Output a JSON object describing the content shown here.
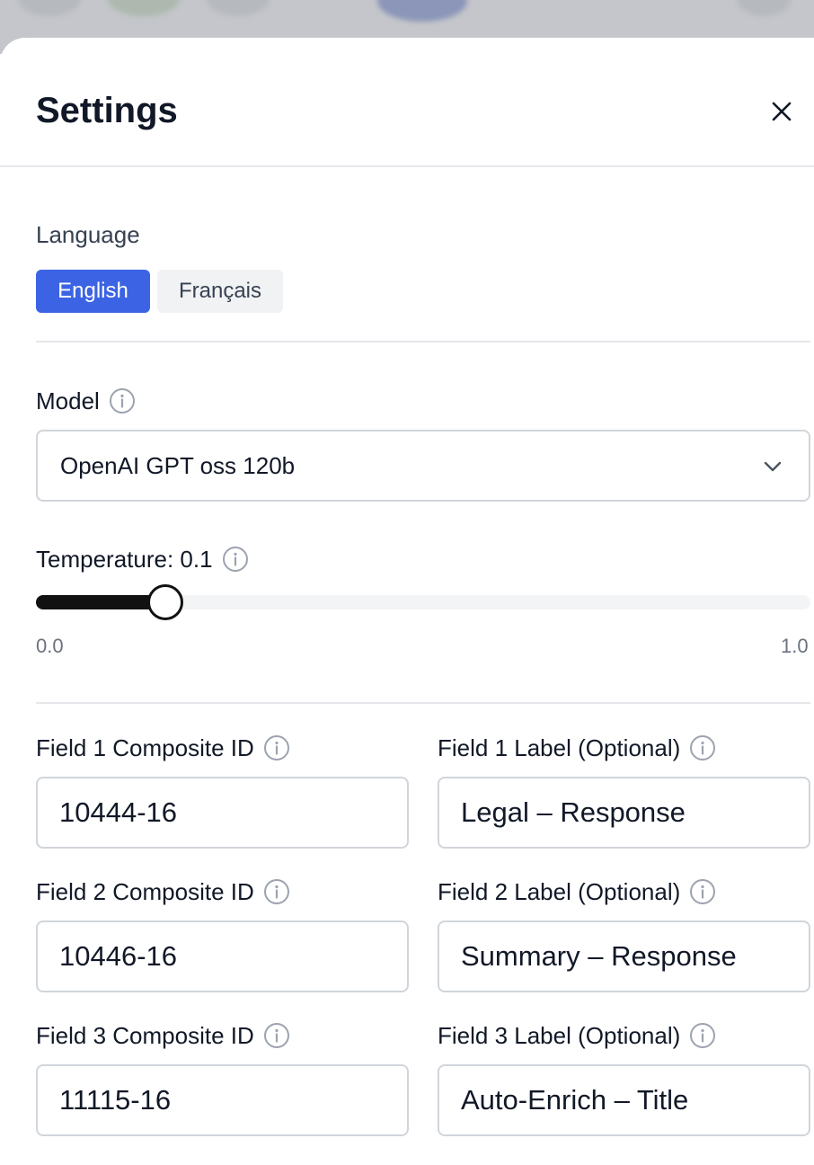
{
  "settings": {
    "title": "Settings",
    "language": {
      "label": "Language",
      "options": [
        "English",
        "Français"
      ],
      "selected": "English"
    },
    "model": {
      "label": "Model",
      "selected_value": "OpenAI GPT oss 120b"
    },
    "temperature": {
      "label": "Temperature: 0.1",
      "value": 0.1,
      "min_label": "0.0",
      "max_label": "1.0"
    },
    "fields": [
      {
        "id_label": "Field 1 Composite ID",
        "id_value": "10444-16",
        "name_label": "Field 1 Label (Optional)",
        "name_value": "Legal – Response"
      },
      {
        "id_label": "Field 2 Composite ID",
        "id_value": "10446-16",
        "name_label": "Field 2 Label (Optional)",
        "name_value": "Summary – Response"
      },
      {
        "id_label": "Field 3 Composite ID",
        "id_value": "11115-16",
        "name_label": "Field 3 Label (Optional)",
        "name_value": "Auto-Enrich – Title"
      }
    ]
  },
  "colors": {
    "accent": "#3b63e3",
    "title_text": "#111827",
    "muted_text": "#6b7280",
    "border": "#d1d5db"
  },
  "icons": {
    "close": "close-icon",
    "info": "info-icon",
    "chevron": "chevron-down-icon"
  }
}
